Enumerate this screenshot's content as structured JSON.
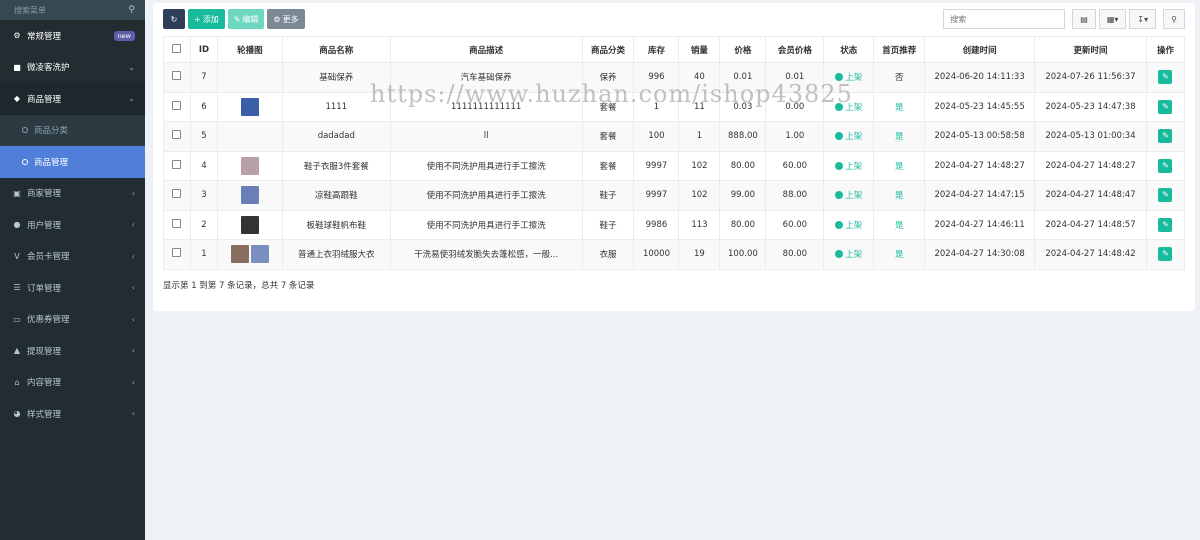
{
  "sidebar": {
    "search_placeholder": "搜索菜单",
    "items": [
      {
        "label": "常规管理",
        "badge": "new"
      },
      {
        "label": "微凌客洗护"
      },
      {
        "label": "商品管理"
      },
      {
        "label": "商品分类"
      },
      {
        "label": "商品管理"
      },
      {
        "label": "商家管理"
      },
      {
        "label": "用户管理"
      },
      {
        "label": "会员卡管理"
      },
      {
        "label": "订单管理"
      },
      {
        "label": "优惠券管理"
      },
      {
        "label": "提现管理"
      },
      {
        "label": "内容管理"
      },
      {
        "label": "样式管理"
      }
    ]
  },
  "toolbar": {
    "add": "添加",
    "edit": "编辑",
    "more": "更多",
    "search_placeholder": "搜索"
  },
  "table": {
    "headers": [
      "ID",
      "轮播图",
      "商品名称",
      "商品描述",
      "商品分类",
      "库存",
      "销量",
      "价格",
      "会员价格",
      "状态",
      "首页推荐",
      "创建时间",
      "更新时间",
      "操作"
    ],
    "rows": [
      {
        "id": "7",
        "name": "基础保养",
        "desc": "汽车基础保养",
        "cat": "保养",
        "stock": "996",
        "sales": "40",
        "price": "0.01",
        "vip": "0.01",
        "status": "上架",
        "rec": "否",
        "created": "2024-06-20 14:11:33",
        "updated": "2024-07-26 11:56:37"
      },
      {
        "id": "6",
        "name": "1111",
        "desc": "1111111111111",
        "cat": "套餐",
        "stock": "1",
        "sales": "11",
        "price": "0.03",
        "vip": "0.00",
        "status": "上架",
        "rec": "是",
        "created": "2024-05-23 14:45:55",
        "updated": "2024-05-23 14:47:38"
      },
      {
        "id": "5",
        "name": "dadadad",
        "desc": "ll",
        "cat": "套餐",
        "stock": "100",
        "sales": "1",
        "price": "888.00",
        "vip": "1.00",
        "status": "上架",
        "rec": "是",
        "created": "2024-05-13 00:58:58",
        "updated": "2024-05-13 01:00:34"
      },
      {
        "id": "4",
        "name": "鞋子衣服3件套餐",
        "desc": "使用不同洗护用具进行手工擦洗",
        "cat": "套餐",
        "stock": "9997",
        "sales": "102",
        "price": "80.00",
        "vip": "60.00",
        "status": "上架",
        "rec": "是",
        "created": "2024-04-27 14:48:27",
        "updated": "2024-04-27 14:48:27"
      },
      {
        "id": "3",
        "name": "凉鞋高跟鞋",
        "desc": "使用不同洗护用具进行手工擦洗",
        "cat": "鞋子",
        "stock": "9997",
        "sales": "102",
        "price": "99.00",
        "vip": "88.00",
        "status": "上架",
        "rec": "是",
        "created": "2024-04-27 14:47:15",
        "updated": "2024-04-27 14:48:47"
      },
      {
        "id": "2",
        "name": "板鞋球鞋帆布鞋",
        "desc": "使用不同洗护用具进行手工擦洗",
        "cat": "鞋子",
        "stock": "9986",
        "sales": "113",
        "price": "80.00",
        "vip": "60.00",
        "status": "上架",
        "rec": "是",
        "created": "2024-04-27 14:46:11",
        "updated": "2024-04-27 14:48:57"
      },
      {
        "id": "1",
        "name": "普通上衣羽绒服大衣",
        "desc": "干洗易使羽绒发脆失去蓬松感，一般...",
        "cat": "衣服",
        "stock": "10000",
        "sales": "19",
        "price": "100.00",
        "vip": "80.00",
        "status": "上架",
        "rec": "是",
        "created": "2024-04-27 14:30:08",
        "updated": "2024-04-27 14:48:42"
      }
    ]
  },
  "footer": "显示第 1 到第 7 条记录，总共 7 条记录",
  "watermark": "https://www.huzhan.com/ishop43825",
  "colors": {
    "accent": "#18bc9c",
    "sidebar": "#222d32",
    "active": "#4f7fd8"
  }
}
